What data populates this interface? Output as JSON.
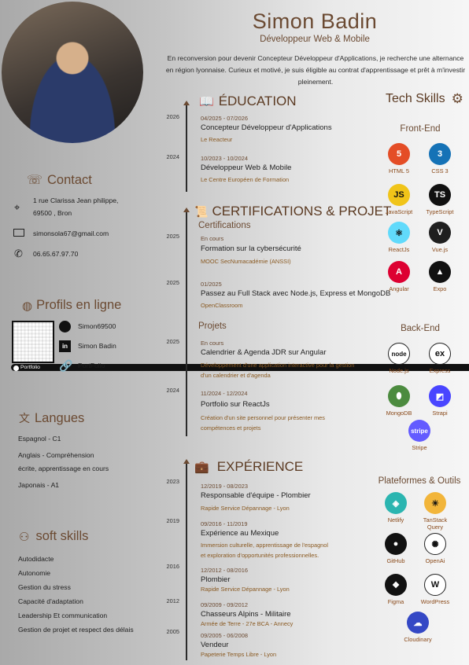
{
  "header": {
    "name": "Simon Badin",
    "job": "Développeur Web & Mobile",
    "intro": "En reconversion pour devenir Concepteur Développeur d'Applications, je recherche une alternance en région lyonnaise. Curieux et motivé, je suis éligible au contrat d'apprentissage et prêt à m'investir pleinement."
  },
  "contact": {
    "title": "Contact",
    "address_1": "1 rue Clarissa Jean philippe,",
    "address_2": "69500 , Bron",
    "email": "simonsola67@gmail.com",
    "phone": "06.65.67.97.70"
  },
  "profiles": {
    "title": "Profils en ligne",
    "github": "Simon69500",
    "linkedin": "Simon Badin",
    "portfolio": "PortFolio",
    "qr_label": "Portfolio"
  },
  "languages": {
    "title": "Langues",
    "items": [
      "Espagnol - C1",
      "Anglais - Compréhension",
      "écrite, apprentissage en cours",
      "Japonais - A1"
    ]
  },
  "soft": {
    "title": "soft skills",
    "items": [
      "Autodidacte",
      "Autonomie",
      "Gestion du stress",
      "Capacité d'adaptation",
      "Leadership Et communication",
      "Gestion de projet et respect des délais"
    ]
  },
  "education": {
    "title": "ÉDUCATION",
    "items": [
      {
        "year": "2026",
        "date": "04/2025 - 07/2026",
        "title": "Concepteur Développeur d'Applications",
        "sub": "Le Reacteur"
      },
      {
        "year": "2024",
        "date": "10/2023 - 10/2024",
        "title": "Développeur Web & Mobile",
        "sub": "Le Centre Européen de Formation"
      }
    ]
  },
  "certs": {
    "title": "CERTIFICATIONS & PROJET",
    "cert_sub": "Certifications",
    "proj_sub": "Projets",
    "items": [
      {
        "year": "2025",
        "date": "En cours",
        "title": "Formation sur la cybersécurité",
        "sub": "MOOC SecNumacadémie (ANSSI)"
      },
      {
        "year": "2025",
        "date": "01/2025",
        "title": "Passez au Full Stack avec Node.js, Express et MongoDB",
        "sub": "OpenClassroom"
      },
      {
        "year": "2025",
        "date": "En cours",
        "title": "Calendrier & Agenda JDR sur Angular",
        "sub": "Développement d'une application interactive pour la gestion",
        "sub2": "d'un calendrier et d'agenda"
      },
      {
        "year": "2024",
        "date": "11/2024 - 12/2024",
        "title": "Portfolio sur ReactJs",
        "sub": "Création d'un site personnel pour présenter mes",
        "sub2": "compétences et projets"
      }
    ]
  },
  "experience": {
    "title": "EXPÉRIENCE",
    "items": [
      {
        "year": "2023",
        "date": "12/2019 - 08/2023",
        "title": "Responsable d'équipe - Plombier",
        "sub": "Rapide Service Dépannage - Lyon"
      },
      {
        "year": "2019",
        "date": "09/2016 - 11/2019",
        "title": "Expérience au Mexique",
        "sub": "Immersion culturelle, apprentissage de l'espagnol",
        "sub2": "et exploration d'opportunités professionnelles."
      },
      {
        "year": "2016",
        "date": "12/2012 - 08/2016",
        "title": "Plombier",
        "sub": "Rapide Service Dépannage - Lyon"
      },
      {
        "year": "2012",
        "date": "09/2009 - 09/2012",
        "title": "Chasseurs Alpins - Militaire",
        "sub": "Armée de Terre - 27e BCA - Annecy"
      },
      {
        "year": "2005",
        "date": "09/2005 - 06/2008",
        "title": "Vendeur",
        "sub": "Papeterie Temps Libre - Lyon"
      }
    ]
  },
  "tech": {
    "title": "Tech Skills",
    "front_title": "Front-End",
    "back_title": "Back-End",
    "tools_title": "Plateformes & Outils",
    "front": [
      {
        "label": "HTML 5",
        "icon": "html5-icon",
        "glyph": "5",
        "color": "#e44d26"
      },
      {
        "label": "CSS 3",
        "icon": "css3-icon",
        "glyph": "3",
        "color": "#1572b6"
      },
      {
        "label": "JavaScript",
        "icon": "javascript-icon",
        "glyph": "JS",
        "color": "#f0c419"
      },
      {
        "label": "TypeScript",
        "icon": "typescript-icon",
        "glyph": "TS",
        "color": "#111111"
      },
      {
        "label": "ReactJs",
        "icon": "react-icon",
        "glyph": "⚛",
        "color": "#61dafb"
      },
      {
        "label": "Vue.js",
        "icon": "vue-icon",
        "glyph": "V",
        "color": "#1f1f1f"
      },
      {
        "label": "Angular",
        "icon": "angular-icon",
        "glyph": "A",
        "color": "#dd0031"
      },
      {
        "label": "Expo",
        "icon": "expo-icon",
        "glyph": "▲",
        "color": "#111111"
      }
    ],
    "back": [
      {
        "label": "Node.js",
        "icon": "nodejs-icon",
        "glyph": "node",
        "color": "#ffffff"
      },
      {
        "label": "Express",
        "icon": "express-icon",
        "glyph": "ex",
        "color": "#ffffff"
      },
      {
        "label": "MongoDB",
        "icon": "mongodb-icon",
        "glyph": "⬮",
        "color": "#4c8b3f"
      },
      {
        "label": "Strapi",
        "icon": "strapi-icon",
        "glyph": "◩",
        "color": "#4945ff"
      },
      {
        "label": "Stripe",
        "icon": "stripe-icon",
        "glyph": "stripe",
        "color": "#635bff"
      }
    ],
    "tools": [
      {
        "label": "Netlify",
        "icon": "netlify-icon",
        "glyph": "◈",
        "color": "#2bb5b0"
      },
      {
        "label": "TanStack Query",
        "icon": "tanstack-icon",
        "glyph": "☀",
        "color": "#f2b53a"
      },
      {
        "label": "GitHub",
        "icon": "github-icon",
        "glyph": "●",
        "color": "#111111"
      },
      {
        "label": "OpenAi",
        "icon": "openai-icon",
        "glyph": "✺",
        "color": "#ffffff"
      },
      {
        "label": "Figma",
        "icon": "figma-icon",
        "glyph": "❖",
        "color": "#111111"
      },
      {
        "label": "WordPress",
        "icon": "wordpress-icon",
        "glyph": "W",
        "color": "#ffffff"
      },
      {
        "label": "Cloudinary",
        "icon": "cloudinary-icon",
        "glyph": "☁",
        "color": "#3448c5"
      }
    ]
  }
}
